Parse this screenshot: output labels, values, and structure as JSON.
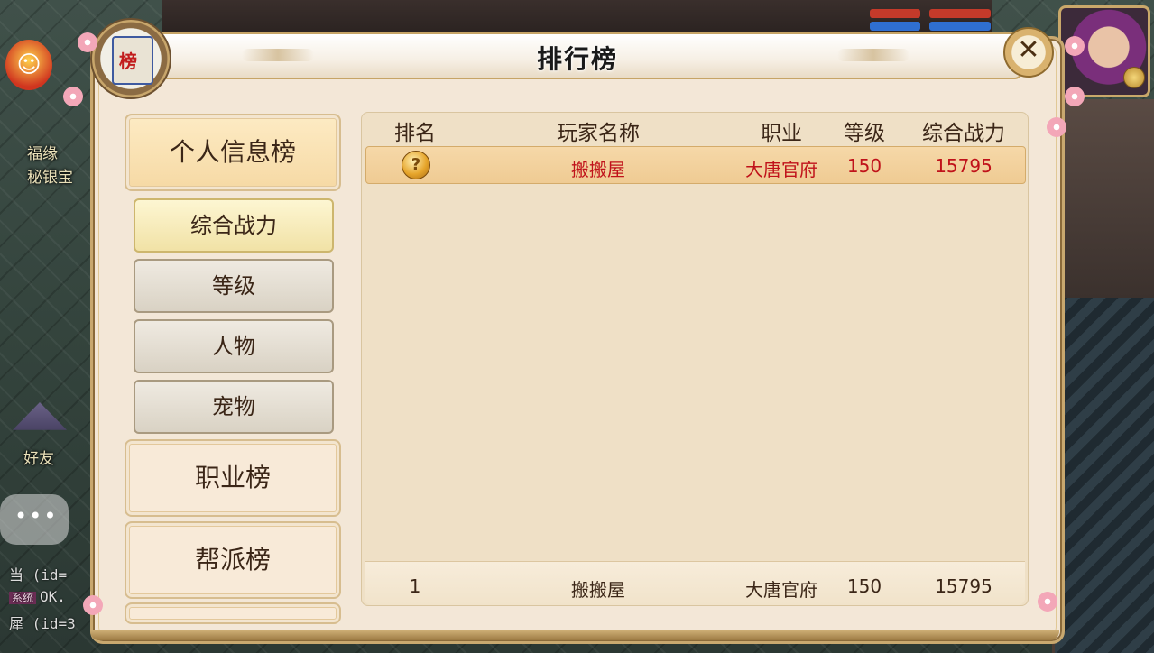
{
  "side": {
    "fortune_label": "福缘",
    "treasure_label": "秘银宝",
    "friend_label": "好友",
    "chat_dots": "•••",
    "log_lines": [
      {
        "tag": "",
        "text": "当 (id="
      },
      {
        "tag": "系统",
        "text": "OK."
      },
      {
        "tag": "",
        "text": "犀 (id=3"
      }
    ]
  },
  "panel": {
    "title": "排行榜",
    "emblem_text": "榜",
    "close_icon": "✕"
  },
  "categories": {
    "personal": "个人信息榜",
    "job": "职业榜",
    "guild": "帮派榜"
  },
  "sub_tabs": [
    "综合战力",
    "等级",
    "人物",
    "宠物"
  ],
  "table": {
    "headers": {
      "rank": "排名",
      "name": "玩家名称",
      "job": "职业",
      "level": "等级",
      "power": "综合战力"
    },
    "rows": [
      {
        "rank_icon": "?",
        "name": "搬搬屋",
        "job": "大唐官府",
        "level": "150",
        "power": "15795"
      }
    ],
    "my_row": {
      "rank": "1",
      "name": "搬搬屋",
      "job": "大唐官府",
      "level": "150",
      "power": "15795"
    }
  },
  "colors": {
    "highlight_text": "#c0121a",
    "normal_text": "#3b2617",
    "panel_bg": "#f3e7d7",
    "border": "#c8a86f"
  }
}
